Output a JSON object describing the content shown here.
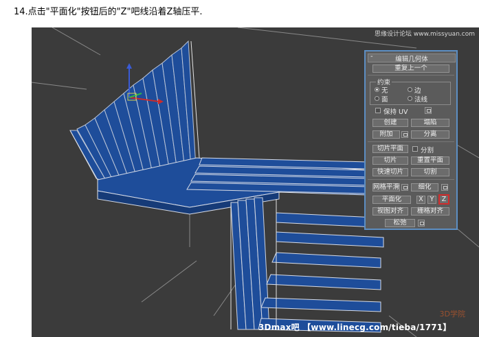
{
  "caption": "14.点击\"平面化\"按钮后的\"Z\"吧线沿着Z轴压平.",
  "viewport": {
    "label": "",
    "watermark_top": "思缘设计论坛 www.missyuan.com",
    "watermark_bottom": "3Dmax吧 【www.linecg.com/tieba/1771】",
    "corner_logo": "3D学院"
  },
  "panel": {
    "collapse_symbol": "-",
    "title": "编辑几何体",
    "repeat_last": "重复上一个",
    "constraints": {
      "title": "约束",
      "options": [
        "无",
        "边",
        "面",
        "法线"
      ],
      "selected": "无"
    },
    "preserve_uv": "保持 UV",
    "create": "创建",
    "collapse": "塌陷",
    "attach": "附加",
    "detach": "分离",
    "slice_plane": "切片平面",
    "split": "分割",
    "slice": "切片",
    "reset_plane": "重置平面",
    "quick_slice": "快速切片",
    "cut": "切割",
    "meshsmooth": "网格平滑",
    "tessellate": "细化",
    "make_planar": "平面化",
    "x": "X",
    "y": "Y",
    "z": "Z",
    "view_align": "视图对齐",
    "grid_align": "栅格对齐",
    "relax": "松弛"
  },
  "colors": {
    "panel_border": "#5d8fc4",
    "highlight": "#d22b2b",
    "mesh_fill": "#1e4d9a",
    "viewport_bg": "#3b3b3b"
  }
}
